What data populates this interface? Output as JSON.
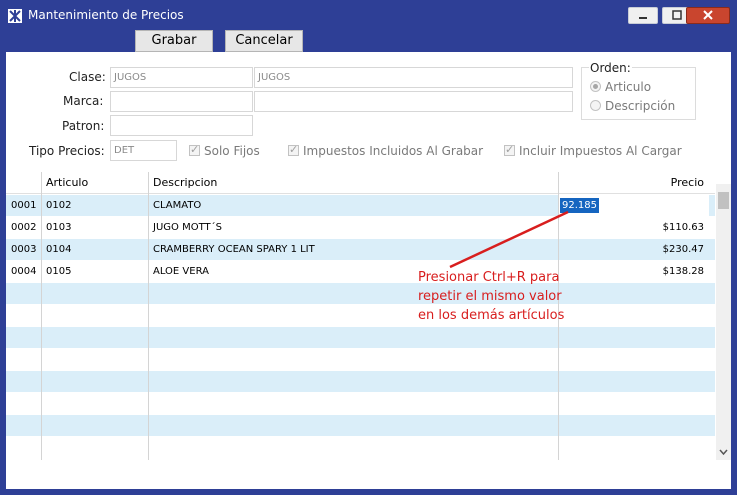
{
  "window": {
    "title": "Mantenimiento de Precios"
  },
  "toolbar": {
    "save_label": "Grabar",
    "cancel_label": "Cancelar"
  },
  "form": {
    "clase_label": "Clase:",
    "clase_code": "JUGOS",
    "clase_desc": "JUGOS",
    "marca_label": "Marca:",
    "marca_code": "",
    "marca_desc": "",
    "patron_label": "Patron:",
    "patron_value": "",
    "tipo_label": "Tipo Precios:",
    "tipo_value": "DET",
    "solo_fijos": "Solo Fijos",
    "impuestos_grabar": "Impuestos Incluidos Al Grabar",
    "impuestos_cargar": "Incluir Impuestos Al Cargar",
    "orden_label": "Orden:",
    "orden_articulo": "Articulo",
    "orden_descripcion": "Descripción"
  },
  "grid": {
    "headers": {
      "articulo": "Articulo",
      "descripcion": "Descripcion",
      "precio": "Precio"
    },
    "rows": [
      {
        "num": "0001",
        "articulo": "0102",
        "descripcion": "CLAMATO",
        "precio": "92.185"
      },
      {
        "num": "0002",
        "articulo": "0103",
        "descripcion": "JUGO MOTT´S",
        "precio": "$110.63"
      },
      {
        "num": "0003",
        "articulo": "0104",
        "descripcion": "CRAMBERRY OCEAN SPARY 1 LIT",
        "precio": "$230.47"
      },
      {
        "num": "0004",
        "articulo": "0105",
        "descripcion": "ALOE VERA",
        "precio": "$138.28"
      }
    ]
  },
  "annotation": {
    "line1": "Presionar Ctrl+R para",
    "line2": "repetir el mismo valor",
    "line3": "en los demás artículos",
    "color": "#e02020"
  },
  "colors": {
    "titlebar": "#2e3f96",
    "row_alt": "#daeef9",
    "selection": "#1565c0"
  }
}
